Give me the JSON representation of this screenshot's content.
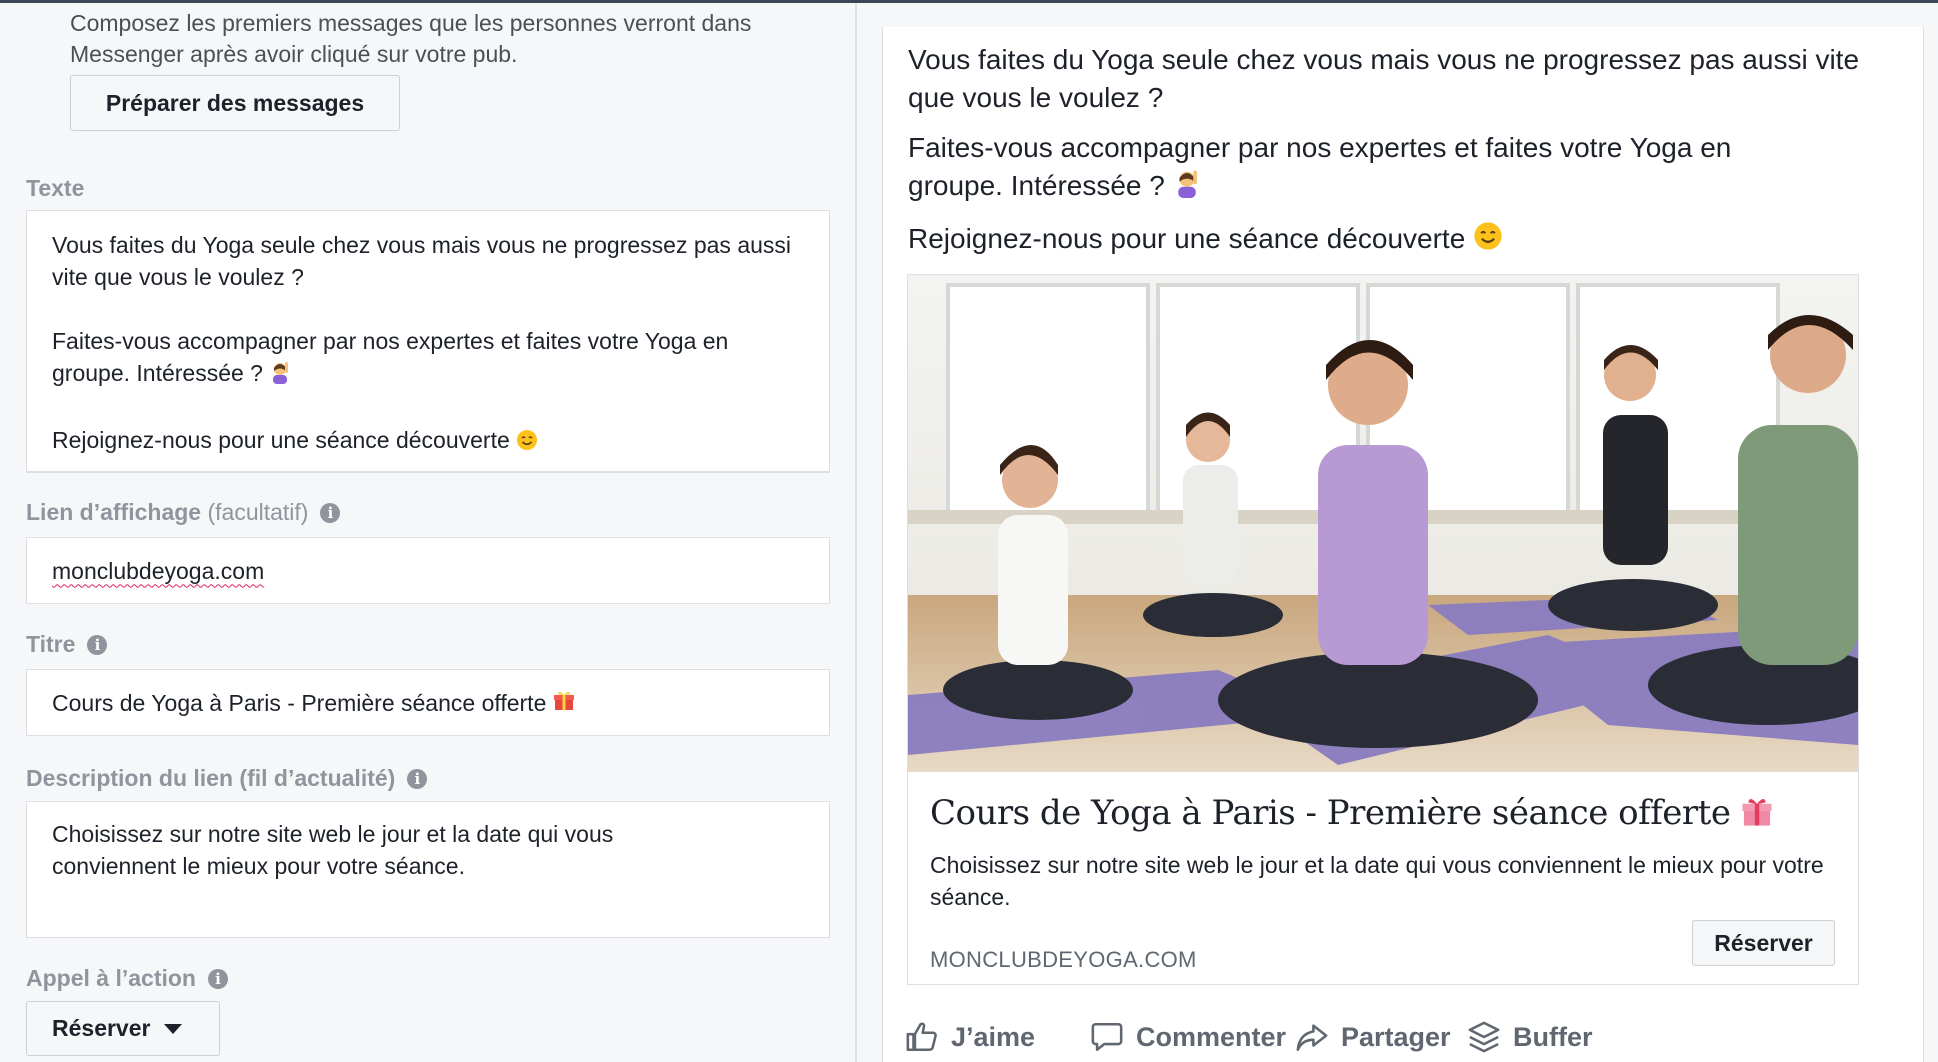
{
  "editor": {
    "messenger_intro": "Composez les premiers messages que les personnes verront dans Messenger après avoir cliqué sur votre pub.",
    "prepare_button": "Préparer des messages",
    "texte_label": "Texte",
    "texte_lines": [
      "Vous faites du Yoga seule chez vous mais vous ne progressez pas aussi vite que vous le voulez ?",
      "Faites-vous accompagner par nos expertes et faites votre Yoga en groupe. Intéressée ?",
      "Rejoignez-nous pour une séance découverte"
    ],
    "lien_label": "Lien d’affichage",
    "lien_optional": "(facultatif)",
    "lien_value": "monclubdeyoga.com",
    "titre_label": "Titre",
    "titre_value": "Cours de Yoga à Paris - Première séance offerte",
    "desc_label": "Description du lien (fil d’actualité)",
    "desc_value": "Choisissez sur notre site web le jour et la date qui vous conviennent le mieux pour votre séance.",
    "cta_label": "Appel à l’action",
    "cta_value": "Réserver"
  },
  "preview": {
    "post_lines": [
      "Vous faites du Yoga seule chez vous mais vous ne progressez pas aussi vite que vous le voulez ?",
      "Faites-vous accompagner par nos expertes et faites votre Yoga en groupe. Intéressée ?",
      "Rejoignez-nous pour une séance découverte"
    ],
    "link_title": "Cours de Yoga à Paris - Première séance offerte",
    "link_description": "Choisissez sur notre site web le jour et la date qui vous conviennent le mieux pour votre séance.",
    "link_domain": "MONCLUBDEYOGA.COM",
    "cta_button": "Réserver",
    "actions": {
      "like": "J’aime",
      "comment": "Commenter",
      "share": "Partager",
      "buffer": "Buffer"
    }
  },
  "icons": [
    "info-icon",
    "raising-hand-emoji",
    "smiling-face-emoji",
    "gift-emoji",
    "caret-down-icon",
    "thumbs-up-icon",
    "comment-icon",
    "share-icon",
    "buffer-icon"
  ],
  "colors": {
    "muted_text": "#90949c",
    "action_text": "#606770",
    "panel_bg": "#f6f7f9",
    "mat_purple": "#8a7cc0"
  }
}
